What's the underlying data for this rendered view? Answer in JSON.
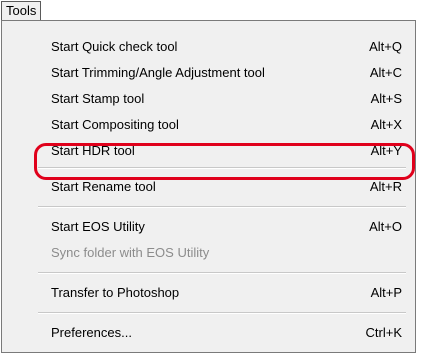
{
  "menubar": {
    "label": "Tools"
  },
  "menu": {
    "items": [
      {
        "label": "Start Quick check tool",
        "shortcut": "Alt+Q",
        "enabled": true
      },
      {
        "label": "Start Trimming/Angle Adjustment tool",
        "shortcut": "Alt+C",
        "enabled": true
      },
      {
        "label": "Start Stamp tool",
        "shortcut": "Alt+S",
        "enabled": true
      },
      {
        "label": "Start Compositing tool",
        "shortcut": "Alt+X",
        "enabled": true
      },
      {
        "label": "Start HDR tool",
        "shortcut": "Alt+Y",
        "enabled": true,
        "highlighted": true
      },
      {
        "label": "Start Rename tool",
        "shortcut": "Alt+R",
        "enabled": true
      },
      {
        "label": "Start EOS Utility",
        "shortcut": "Alt+O",
        "enabled": true
      },
      {
        "label": "Sync folder with EOS Utility",
        "shortcut": "",
        "enabled": false
      },
      {
        "label": "Transfer to Photoshop",
        "shortcut": "Alt+P",
        "enabled": true
      },
      {
        "label": "Preferences...",
        "shortcut": "Ctrl+K",
        "enabled": true
      }
    ]
  },
  "colors": {
    "menu_background": "#f0f0f0",
    "highlight_ring": "#e0001b",
    "disabled_text": "#8c8c8c"
  }
}
